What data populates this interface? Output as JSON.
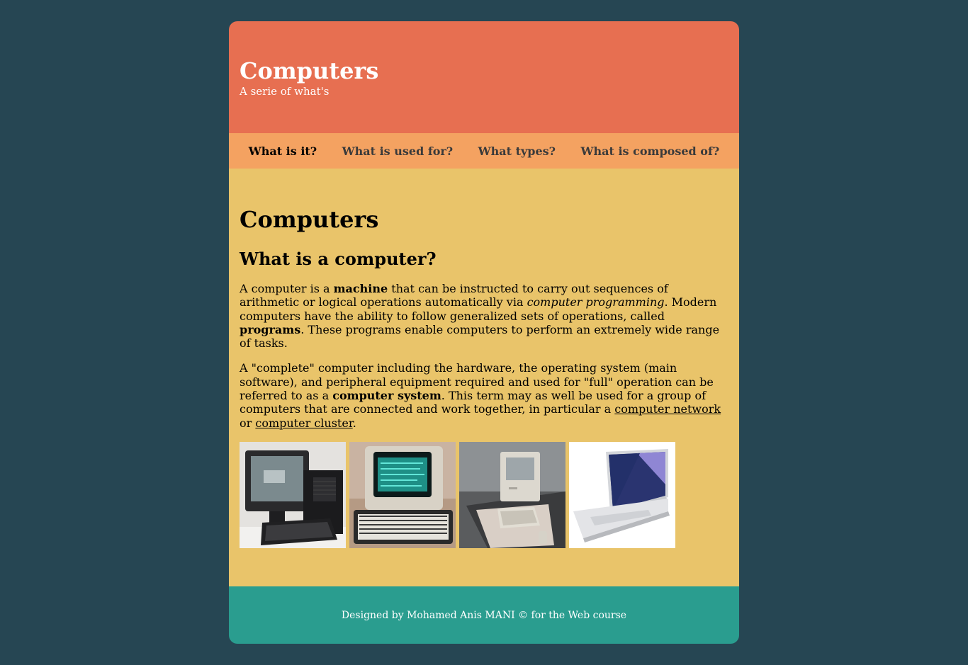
{
  "header": {
    "title": "Computers",
    "subtitle": "A serie of what's"
  },
  "nav": {
    "items": [
      {
        "label": "What is it?",
        "active": true
      },
      {
        "label": "What is used for?",
        "active": false
      },
      {
        "label": "What types?",
        "active": false
      },
      {
        "label": "What is composed of?",
        "active": false
      }
    ]
  },
  "main": {
    "title": "Computers",
    "heading": "What is a computer?",
    "p1": {
      "t1": "A computer is a ",
      "b1": "machine",
      "t2": " that can be instructed to carry out sequences of arithmetic or logical operations automatically via ",
      "i1": "computer programming",
      "t3": ". Modern computers have the ability to follow generalized sets of operations, called ",
      "b2": "programs",
      "t4": ". These programs enable computers to perform an extremely wide range of tasks."
    },
    "p2": {
      "t1": "A \"complete\" computer including the hardware, the operating system (main software), and peripheral equipment required and used for \"full\" operation can be referred to as a ",
      "b1": "computer system",
      "t2": ". This term may as well be used for a group of computers that are connected and work together, in particular a ",
      "link1": "computer network",
      "t3": " or ",
      "link2": "computer cluster",
      "t4": "."
    },
    "gallery": [
      {
        "icon": "next-computer-photo"
      },
      {
        "icon": "vintage-terminal-photo"
      },
      {
        "icon": "macintosh-photo"
      },
      {
        "icon": "laptop-photo"
      }
    ]
  },
  "footer": {
    "text": "Designed by Mohamed Anis MANI © for the Web course"
  },
  "colors": {
    "background": "#264653",
    "header": "#e76f51",
    "nav": "#f4a261",
    "content": "#e9c46a",
    "footer": "#2a9d8f"
  }
}
